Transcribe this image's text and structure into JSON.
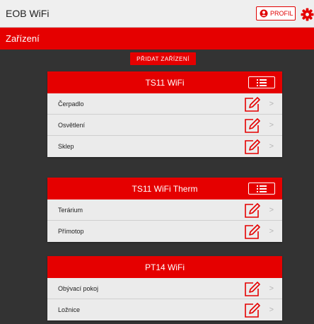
{
  "app": {
    "title": "EOB WiFi"
  },
  "header": {
    "profile_label": "PROFIL"
  },
  "section": {
    "title": "Zařízení"
  },
  "actions": {
    "add_device_label": "PŘIDAT ZAŘÍZENÍ"
  },
  "devices": [
    {
      "name": "TS11 WiFi",
      "items": [
        {
          "label": "Čerpadlo"
        },
        {
          "label": "Osvětlení"
        },
        {
          "label": "Sklep"
        }
      ]
    },
    {
      "name": "TS11 WiFi Therm",
      "items": [
        {
          "label": "Terárium"
        },
        {
          "label": "Přímotop"
        }
      ]
    },
    {
      "name": "PT14 WiFi",
      "items": [
        {
          "label": "Obývací pokoj"
        },
        {
          "label": "Ložnice"
        }
      ]
    }
  ],
  "colors": {
    "accent": "#e50000",
    "background": "#333333",
    "card": "#ebebeb"
  },
  "icons": {
    "profile": "user-circle-icon",
    "settings": "gear-icon",
    "edit": "pencil-square-icon",
    "menu": "list-icon",
    "chevron": "chevron-right-icon"
  }
}
